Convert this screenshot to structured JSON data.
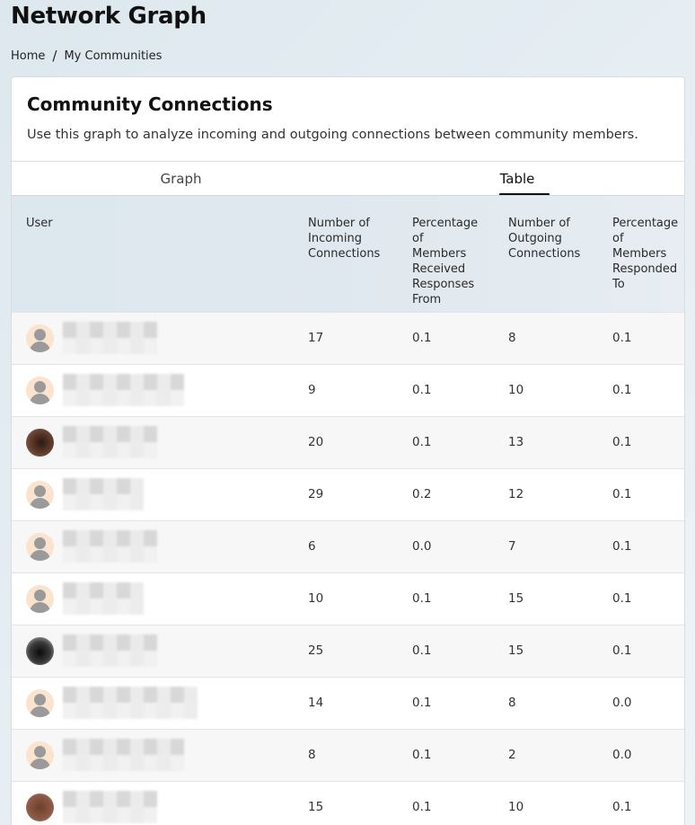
{
  "page": {
    "title": "Network Graph",
    "breadcrumb": {
      "home": "Home",
      "separator": "/",
      "current": "My Communities"
    }
  },
  "card": {
    "title": "Community Connections",
    "description": "Use this graph to analyze incoming and outgoing connections between community members.",
    "tabs": [
      {
        "label": "Graph",
        "active": false
      },
      {
        "label": "Table",
        "active": true
      }
    ]
  },
  "table": {
    "columns": {
      "user": "User",
      "incoming": "Number of\nIncoming\nConnections",
      "pct_received": "Percentage\nof\nMembers\nReceived\nResponses\nFrom",
      "outgoing": "Number of\nOutgoing\nConnections",
      "pct_responded": "Percentage\nof\nMembers\nResponded\nTo"
    },
    "rows": [
      {
        "avatar": "default-avatar-icon",
        "incoming": "17",
        "pct_received": "0.1",
        "outgoing": "8",
        "pct_responded": "0.1"
      },
      {
        "avatar": "default-avatar-icon",
        "incoming": "9",
        "pct_received": "0.1",
        "outgoing": "10",
        "pct_responded": "0.1"
      },
      {
        "avatar": "photo-avatar",
        "incoming": "20",
        "pct_received": "0.1",
        "outgoing": "13",
        "pct_responded": "0.1"
      },
      {
        "avatar": "default-avatar-icon",
        "incoming": "29",
        "pct_received": "0.2",
        "outgoing": "12",
        "pct_responded": "0.1"
      },
      {
        "avatar": "default-avatar-icon",
        "incoming": "6",
        "pct_received": "0.0",
        "outgoing": "7",
        "pct_responded": "0.1"
      },
      {
        "avatar": "default-avatar-icon",
        "incoming": "10",
        "pct_received": "0.1",
        "outgoing": "15",
        "pct_responded": "0.1"
      },
      {
        "avatar": "photo-avatar",
        "incoming": "25",
        "pct_received": "0.1",
        "outgoing": "15",
        "pct_responded": "0.1"
      },
      {
        "avatar": "default-avatar-icon",
        "incoming": "14",
        "pct_received": "0.1",
        "outgoing": "8",
        "pct_responded": "0.0"
      },
      {
        "avatar": "default-avatar-icon",
        "incoming": "8",
        "pct_received": "0.1",
        "outgoing": "2",
        "pct_responded": "0.0"
      },
      {
        "avatar": "photo-avatar",
        "incoming": "15",
        "pct_received": "0.1",
        "outgoing": "10",
        "pct_responded": "0.1"
      }
    ]
  }
}
